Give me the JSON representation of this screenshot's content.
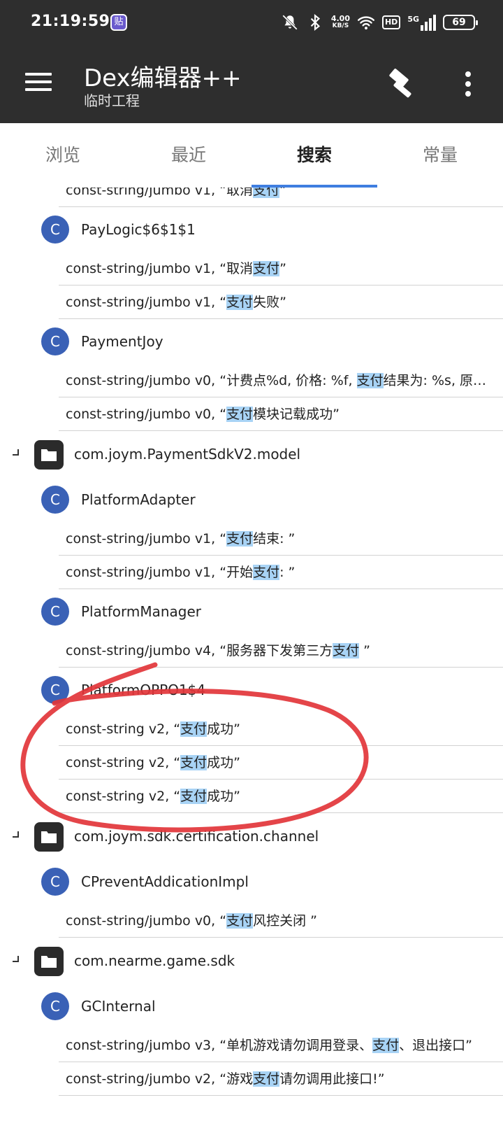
{
  "status_bar": {
    "time": "21:19:59",
    "app_badge": "贴",
    "speed_value": "4.00",
    "speed_unit": "KB/S",
    "hd": "HD",
    "network": "5G",
    "battery": "69"
  },
  "toolbar": {
    "title": "Dex编辑器++",
    "subtitle": "临时工程"
  },
  "tabs": [
    "浏览",
    "最近",
    "搜索",
    "常量"
  ],
  "active_tab": "搜索",
  "highlight_color": "#a8d3f5",
  "results": [
    {
      "kind": "result",
      "pre": "const-string/jumbo v1, “取消",
      "hl": "支付",
      "post": "”"
    },
    {
      "kind": "class",
      "name": "PayLogic$6$1$1"
    },
    {
      "kind": "result",
      "pre": "const-string/jumbo v1, “取消",
      "hl": "支付",
      "post": "”"
    },
    {
      "kind": "result",
      "pre": "const-string/jumbo v1, “",
      "hl": "支付",
      "post": "失败”"
    },
    {
      "kind": "class",
      "name": "PaymentJoy"
    },
    {
      "kind": "result",
      "pre": "const-string/jumbo v0, “计费点%d, 价格: %f, ",
      "hl": "支付",
      "post": "结果为: %s, 原因: %s”"
    },
    {
      "kind": "result",
      "pre": "const-string/jumbo v0, “",
      "hl": "支付",
      "post": "模块记载成功”"
    },
    {
      "kind": "package",
      "name": "com.joym.PaymentSdkV2.model"
    },
    {
      "kind": "class",
      "name": "PlatformAdapter"
    },
    {
      "kind": "result",
      "pre": "const-string/jumbo v1, “",
      "hl": "支付",
      "post": "结束: ”"
    },
    {
      "kind": "result",
      "pre": "const-string/jumbo v1, “开始",
      "hl": "支付",
      "post": ": ”"
    },
    {
      "kind": "class",
      "name": "PlatformManager"
    },
    {
      "kind": "result",
      "pre": "const-string/jumbo v4, “服务器下发第三方",
      "hl": "支付",
      "post": " ”"
    },
    {
      "kind": "class",
      "name": "PlatformOPPO1$4"
    },
    {
      "kind": "result",
      "pre": "const-string v2, “",
      "hl": "支付",
      "post": "成功”"
    },
    {
      "kind": "result",
      "pre": "const-string v2, “",
      "hl": "支付",
      "post": "成功”"
    },
    {
      "kind": "result",
      "pre": "const-string v2, “",
      "hl": "支付",
      "post": "成功”"
    },
    {
      "kind": "package",
      "name": "com.joym.sdk.certification.channel"
    },
    {
      "kind": "class",
      "name": "CPreventAddicationImpl"
    },
    {
      "kind": "result",
      "pre": "const-string/jumbo v0, “",
      "hl": "支付",
      "post": "风控关闭 ”"
    },
    {
      "kind": "package",
      "name": "com.nearme.game.sdk"
    },
    {
      "kind": "class",
      "name": "GCInternal"
    },
    {
      "kind": "result",
      "pre": "const-string/jumbo v3, “单机游戏请勿调用登录、",
      "hl": "支付",
      "post": "、退出接口”"
    },
    {
      "kind": "result",
      "pre": "const-string/jumbo v2, “游戏",
      "hl": "支付",
      "post": "请勿调用此接口!”"
    }
  ],
  "class_badge_letter": "C"
}
